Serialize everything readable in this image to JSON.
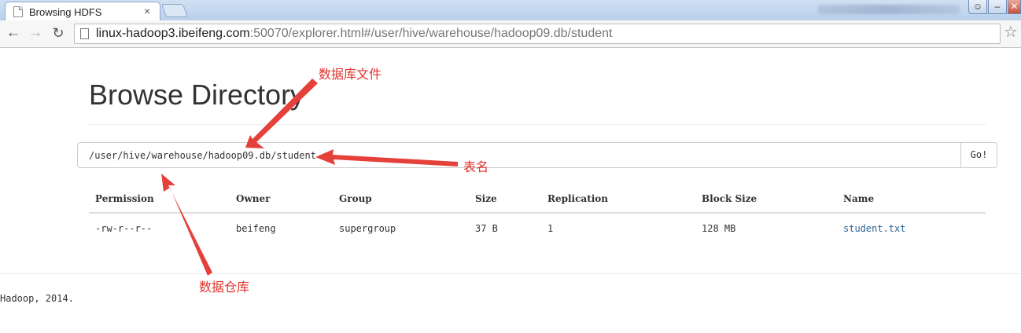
{
  "browser": {
    "tab_title": "Browsing HDFS",
    "tab_close": "×",
    "url_host": "linux-hadoop3.ibeifeng.com",
    "url_rest": ":50070/explorer.html#/user/hive/warehouse/hadoop09.db/student",
    "back_glyph": "←",
    "forward_glyph": "→",
    "reload_glyph": "↻",
    "star_glyph": "☆",
    "min_glyph": "–",
    "close_glyph": "✕",
    "user_glyph": "☺"
  },
  "page": {
    "title": "Browse Directory",
    "path_value": "/user/hive/warehouse/hadoop09.db/student",
    "go_label": "Go!"
  },
  "table": {
    "headers": [
      "Permission",
      "Owner",
      "Group",
      "Size",
      "Replication",
      "Block Size",
      "Name"
    ],
    "rows": [
      [
        "-rw-r--r--",
        "beifeng",
        "supergroup",
        "37 B",
        "1",
        "128 MB",
        "student.txt"
      ]
    ]
  },
  "footer": {
    "text": "Hadoop, 2014."
  },
  "annotations": {
    "database_file": "数据库文件",
    "table_name": "表名",
    "data_warehouse": "数据仓库"
  },
  "colors": {
    "annotation": "#e0332e",
    "link": "#2a6496",
    "text": "#333333"
  }
}
